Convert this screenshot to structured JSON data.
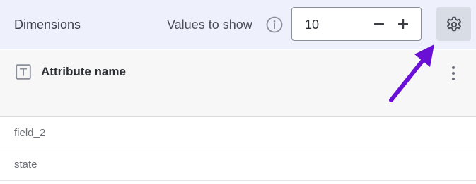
{
  "header": {
    "title": "Dimensions",
    "values_label": "Values to show",
    "info_icon": "info-icon",
    "stepper": {
      "value": "10",
      "minus_icon": "minus-icon",
      "plus_icon": "plus-icon"
    },
    "settings_icon": "gear-icon"
  },
  "attribute": {
    "type_icon": "text-type-icon",
    "name": "Attribute name",
    "menu_icon": "more-vertical-icon"
  },
  "rows": [
    {
      "label": "field_2"
    },
    {
      "label": "state"
    }
  ],
  "annotation": {
    "arrow_color": "#6a0fd6"
  },
  "colors": {
    "header_bg": "#eef1fb",
    "settings_bg": "#d8dce5",
    "attr_row_bg": "#f7f7f8"
  }
}
